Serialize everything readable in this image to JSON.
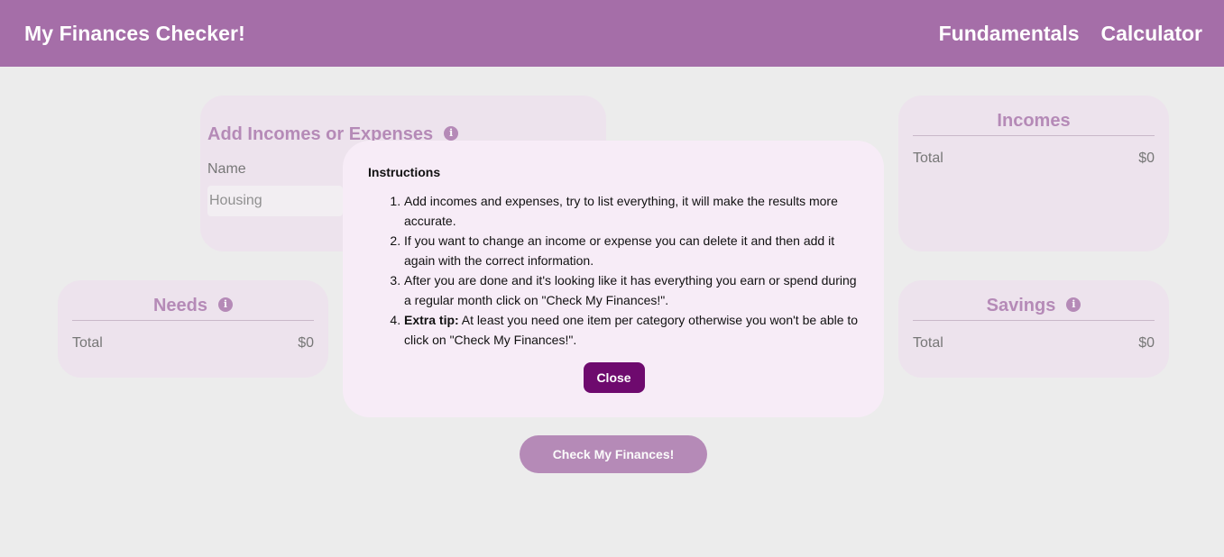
{
  "header": {
    "brand": "My Finances Checker!",
    "nav": [
      "Fundamentals",
      "Calculator"
    ]
  },
  "add_card": {
    "title": "Add Incomes or Expenses",
    "name_label": "Name",
    "name_placeholder": "Housing"
  },
  "incomes": {
    "title": "Incomes",
    "total_label": "Total",
    "total_value": "$0"
  },
  "needs": {
    "title": "Needs",
    "total_label": "Total",
    "total_value": "$0"
  },
  "savings": {
    "title": "Savings",
    "total_label": "Total",
    "total_value": "$0"
  },
  "check_button": "Check My Finances!",
  "modal": {
    "title": "Instructions",
    "items": [
      "Add incomes and expenses, try to list everything, it will make the results more accurate.",
      "If you want to change an income or expense you can delete it and then add it again with the correct information.",
      "After you are done and it's looking like it has everything you earn or spend during a regular month click on \"Check My Finances!\"."
    ],
    "tip_label": "Extra tip:",
    "tip_text": " At least you need one item per category otherwise you won't be able to click on \"Check My Finances!\".",
    "close_label": "Close"
  },
  "colors": {
    "accent": "#a56ea8",
    "close_button": "#6e0a6e",
    "modal_bg": "#f7ecf7"
  },
  "icons": {
    "info": "info-icon"
  }
}
